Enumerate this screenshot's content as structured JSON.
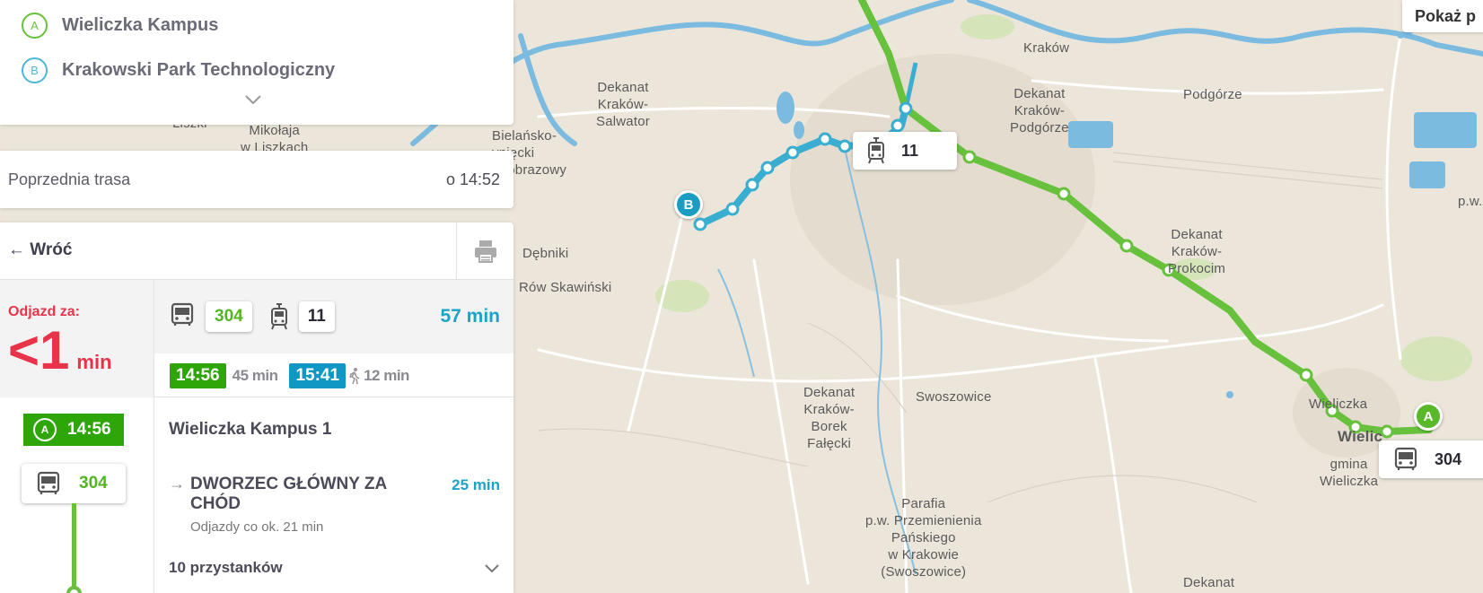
{
  "route": {
    "from_letter": "A",
    "from": "Wieliczka Kampus",
    "to_letter": "B",
    "to": "Krakowski Park Technologiczny"
  },
  "previous": {
    "label": "Poprzednia trasa",
    "time": "o 14:52"
  },
  "nav": {
    "back": "← Wróć"
  },
  "summary": {
    "depart_label": "Odjazd za:",
    "depart_value": "<1",
    "depart_unit": "min",
    "bus_line": "304",
    "tram_line": "11",
    "duration": "57 min",
    "start_time": "14:56",
    "ride_gap": "45 min",
    "arrival_time": "15:41",
    "walk": "12 min"
  },
  "detail": {
    "start_letter": "A",
    "start_time": "14:56",
    "line": "304",
    "stop_name": "Wieliczka Kampus 1",
    "direction": "DWORZEC GŁÓWNY ZA CHÓD",
    "frequency": "Odjazdy co ok. 21 min",
    "ride_duration": "25 min",
    "stops_count": "10 przystanków"
  },
  "map": {
    "show_button": "Pokaż p",
    "tram_tag": "11",
    "bus_tag": "304",
    "pin_a": "A",
    "pin_b": "B",
    "labels": {
      "krakow": "Kraków",
      "podgorze": "Podgórze",
      "dekanat_salwator": "Dekanat\nKraków-\nSalwator",
      "dekanat_podgorze": "Dekanat\nKraków-\nPodgórze",
      "bielansko": "Bielańsko-\nynięcki\nrajobrazowy",
      "dekanat_prokocim": "Dekanat\nKraków-\nProkocim",
      "debniki": "Dębniki",
      "row_skawinski": "Rów Skawiński",
      "dekanat_borek": "Dekanat\nKraków-\nBorek\nFałęcki",
      "swoszowice": "Swoszowice",
      "wieliczka": "Wieliczka",
      "wielic": "Wielic",
      "gmina_wieliczka": "gmina\nWieliczka",
      "parafia": "Parafia\np.w. Przemienienia\nPańskiego\nw Krakowie\n(Swoszowice)",
      "dekanat_bottom": "Dekanat",
      "liszki": "Liszki",
      "mikolaja": "Mikołaja\nw Liszkach",
      "pw": "p.w."
    }
  },
  "colors": {
    "bus_green": "#68c13c",
    "tram_blue": "#39aed0",
    "alert_red": "#e8344a",
    "duration_blue": "#1ba3c9"
  }
}
